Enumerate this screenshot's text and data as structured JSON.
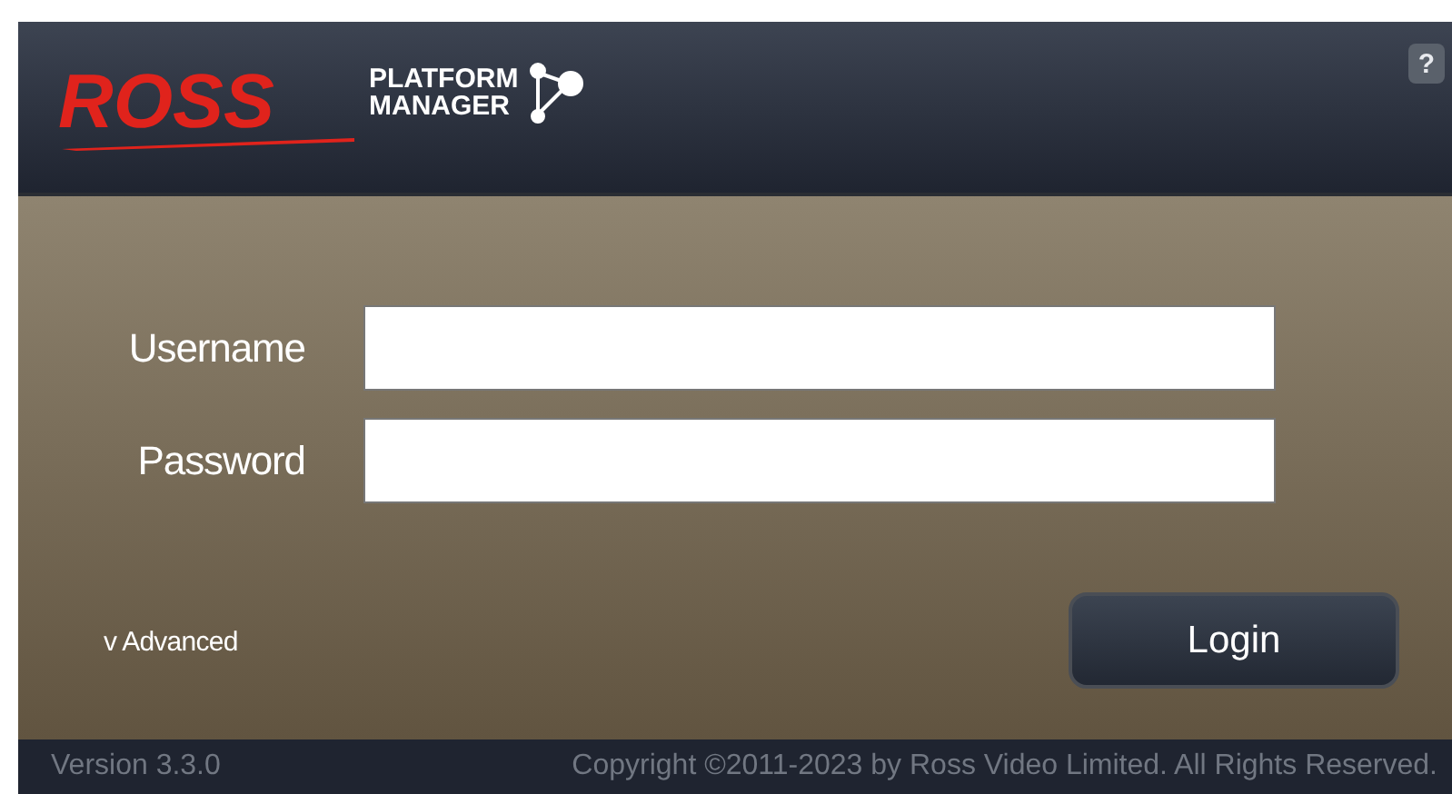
{
  "header": {
    "logo_brand": "ROSS",
    "logo_product": [
      "PLATFORM",
      "MANAGER"
    ],
    "help": "?"
  },
  "form": {
    "fields": [
      {
        "label": "Username"
      },
      {
        "label": "Password"
      }
    ],
    "advanced": "v Advanced",
    "login": "Login"
  },
  "footer": {
    "version": "Version 3.3.0",
    "copyright": "Copyright ©2011-2023 by Ross Video Limited. All Rights Reserved."
  }
}
